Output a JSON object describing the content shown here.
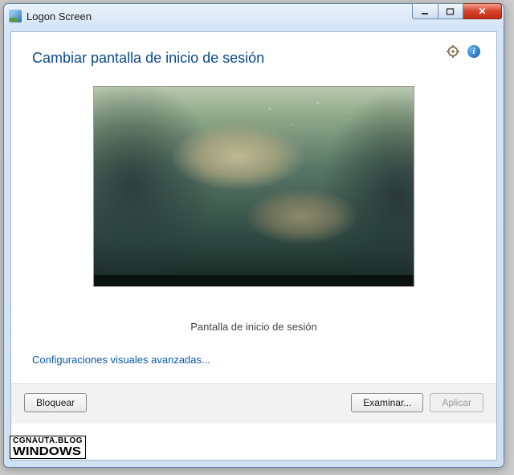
{
  "window": {
    "title": "Logon Screen"
  },
  "header": {
    "page_title": "Cambiar pantalla de inicio de sesión"
  },
  "preview": {
    "caption": "Pantalla de inicio de sesión"
  },
  "links": {
    "advanced": "Configuraciones visuales avanzadas..."
  },
  "footer": {
    "lock": "Bloquear",
    "browse": "Examinar...",
    "apply": "Aplicar"
  },
  "watermark": {
    "line1": "CGNAUTA.BLOG",
    "line2": "WINDOWS"
  }
}
